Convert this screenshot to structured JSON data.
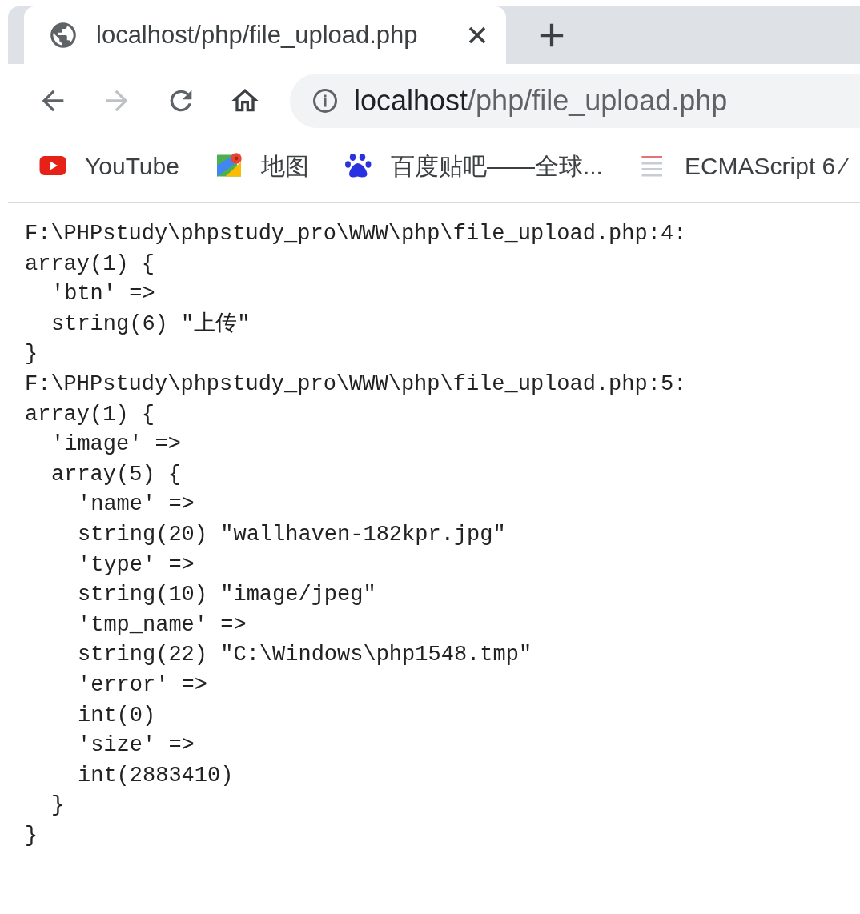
{
  "tabs": [
    {
      "title": "localhost/php/file_upload.php",
      "selected": true
    }
  ],
  "address_bar": {
    "host": "localhost",
    "path": "/php/file_upload.php"
  },
  "bookmarks": [
    {
      "kind": "youtube",
      "label": "YouTube"
    },
    {
      "kind": "maps",
      "label": "地图"
    },
    {
      "kind": "paw",
      "label": "百度贴吧——全球..."
    },
    {
      "kind": "book",
      "label": "ECMAScript 6 ∕"
    }
  ],
  "output": [
    {
      "text": "F:\\PHPstudy\\phpstudy_pro\\WWW\\php\\file_upload.php:4:"
    },
    {
      "text": "array(1) {",
      "children": [
        {
          "text": "'btn' =>"
        },
        {
          "text": "string(6) \"上传\""
        }
      ]
    },
    {
      "text": "}"
    },
    {
      "text": "F:\\PHPstudy\\phpstudy_pro\\WWW\\php\\file_upload.php:5:"
    },
    {
      "text": "array(1) {",
      "children": [
        {
          "text": "'image' =>"
        },
        {
          "text": "array(5) {",
          "children": [
            {
              "text": "'name' =>"
            },
            {
              "text": "string(20) \"wallhaven-182kpr.jpg\""
            },
            {
              "text": "'type' =>"
            },
            {
              "text": "string(10) \"image/jpeg\""
            },
            {
              "text": "'tmp_name' =>"
            },
            {
              "text": "string(22) \"C:\\Windows\\php1548.tmp\""
            },
            {
              "text": "'error' =>"
            },
            {
              "text": "int(0)"
            },
            {
              "text": "'size' =>"
            },
            {
              "text": "int(2883410)"
            }
          ]
        },
        {
          "text": "}"
        }
      ]
    },
    {
      "text": "}"
    }
  ]
}
